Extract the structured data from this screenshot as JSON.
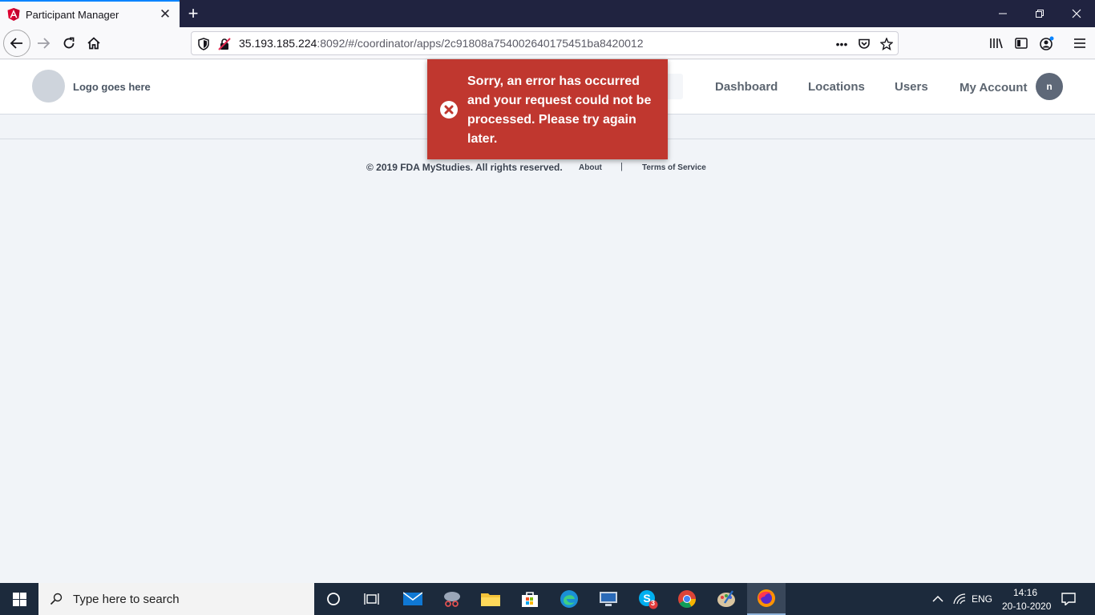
{
  "browser": {
    "tab_title": "Participant Manager",
    "url_host": "35.193.185.224",
    "url_rest": ":8092/#/coordinator/apps/2c91808a754002640175451ba8420012",
    "colors": {
      "tabstrip": "#202340",
      "accent": "#0a84ff"
    }
  },
  "app": {
    "logo_text": "Logo goes here",
    "nav": [
      {
        "label": "Dashboard"
      },
      {
        "label": "Locations"
      },
      {
        "label": "Users"
      },
      {
        "label": "My Account"
      }
    ],
    "avatar_initial": "n"
  },
  "toast": {
    "message": "Sorry, an error has occurred and your request could not be processed. Please try again later.",
    "icon": "close-circle-icon",
    "color": "#c0372f"
  },
  "footer": {
    "copyright": "© 2019 FDA MyStudies. All rights reserved.",
    "about": "About",
    "separator": "|",
    "terms": "Terms of Service"
  },
  "taskbar": {
    "search_placeholder": "Type here to search",
    "skype_badge": "3",
    "language": "ENG",
    "time": "14:16",
    "date": "20-10-2020"
  }
}
